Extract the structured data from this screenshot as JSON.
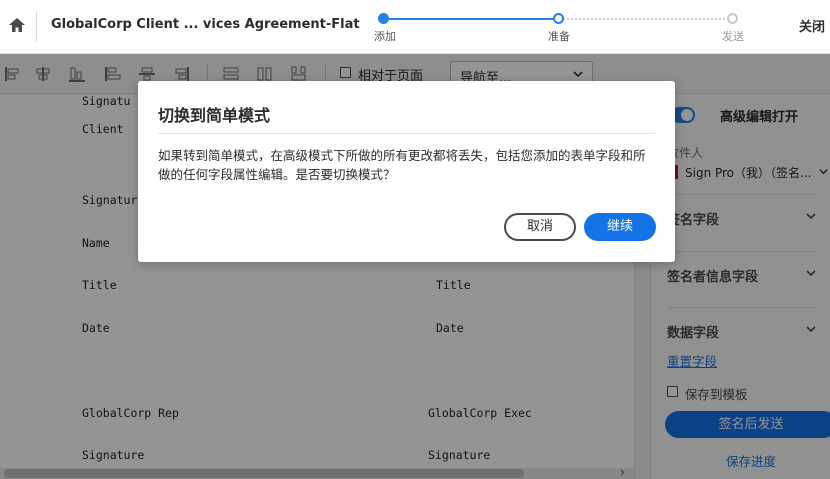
{
  "header": {
    "doc_title": "GlobalCorp Client ... vices Agreement-Flat",
    "steps": [
      "添加",
      "准备",
      "发送"
    ],
    "close_label": "关闭"
  },
  "toolbar": {
    "relative_page_label": "相对于页面",
    "nav_select_value": "导航至..."
  },
  "document": {
    "lines": [
      "Signatu",
      "Client",
      "Signatur",
      "Name",
      "Title",
      "Title",
      "Date",
      "Date",
      "GlobalCorp Rep",
      "GlobalCorp Exec",
      "Signature",
      "Signature"
    ]
  },
  "panel": {
    "toggle_label": "高级编辑打开",
    "recipients_label": "收件人",
    "recipient_value": "Sign Pro（我）（签名...",
    "sections": [
      "签名字段",
      "签名者信息字段",
      "数据字段"
    ],
    "reset_link": "重置字段",
    "save_template_label": "保存到模板",
    "send_button": "签名后发送",
    "save_progress": "保存进度"
  },
  "modal": {
    "title": "切换到简单模式",
    "body": "如果转到简单模式，在高级模式下所做的所有更改都将丢失，包括您添加的表单字段和所做的任何字段属性编辑。是否要切换模式？",
    "cancel_label": "取消",
    "continue_label": "继续"
  },
  "colors": {
    "accent": "#1473e6",
    "step_active": "#2680eb",
    "recipient_marker": "#d3007a"
  }
}
